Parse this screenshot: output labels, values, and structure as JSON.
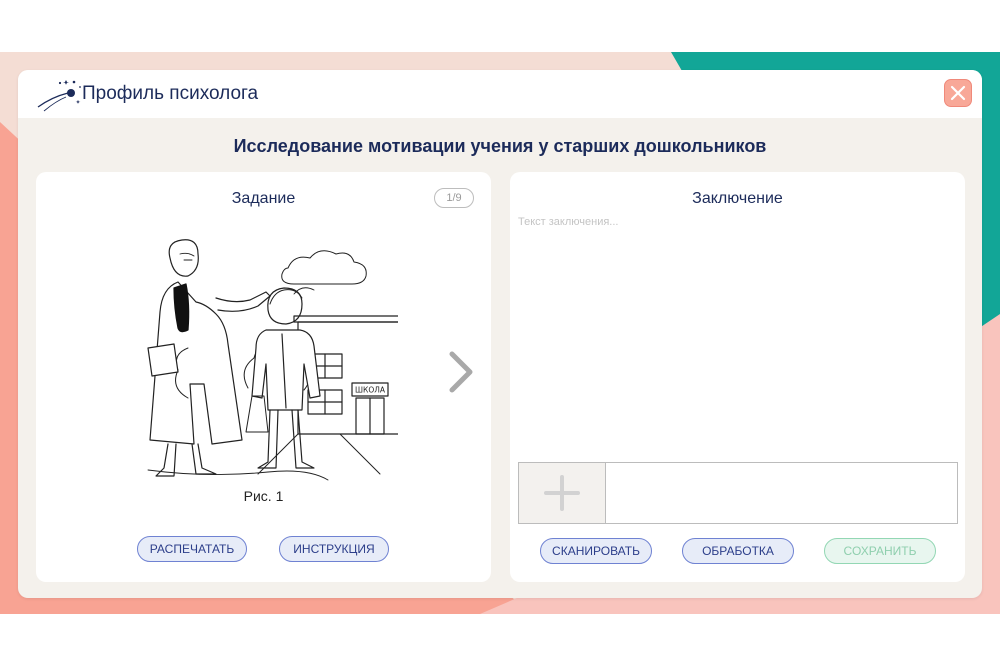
{
  "app": {
    "title": "Профиль психолога",
    "accent_color": "#1c2b5a",
    "close_icon": "close-icon"
  },
  "page": {
    "heading": "Исследование мотивации учения у старших дошкольников"
  },
  "task_panel": {
    "title": "Задание",
    "page_counter": "1/9",
    "figure_caption": "Рис. 1",
    "sign_text": "ШКОЛА",
    "print_button": "РАСПЕЧАТАТЬ",
    "instruction_button": "ИНСТРУКЦИЯ",
    "next_icon": "chevron-right-icon"
  },
  "conclusion_panel": {
    "title": "Заключение",
    "placeholder": "Текст заключения...",
    "add_icon": "plus-icon",
    "scan_button": "СКАНИРОВАТЬ",
    "process_button": "ОБРАБОТКА",
    "save_button": "СОХРАНИТЬ"
  },
  "colors": {
    "teal": "#12a697",
    "salmon": "#f8a393",
    "peach": "#f4ddd4",
    "button_border_blue": "#6f82d2",
    "button_border_green": "#93d7b4"
  }
}
